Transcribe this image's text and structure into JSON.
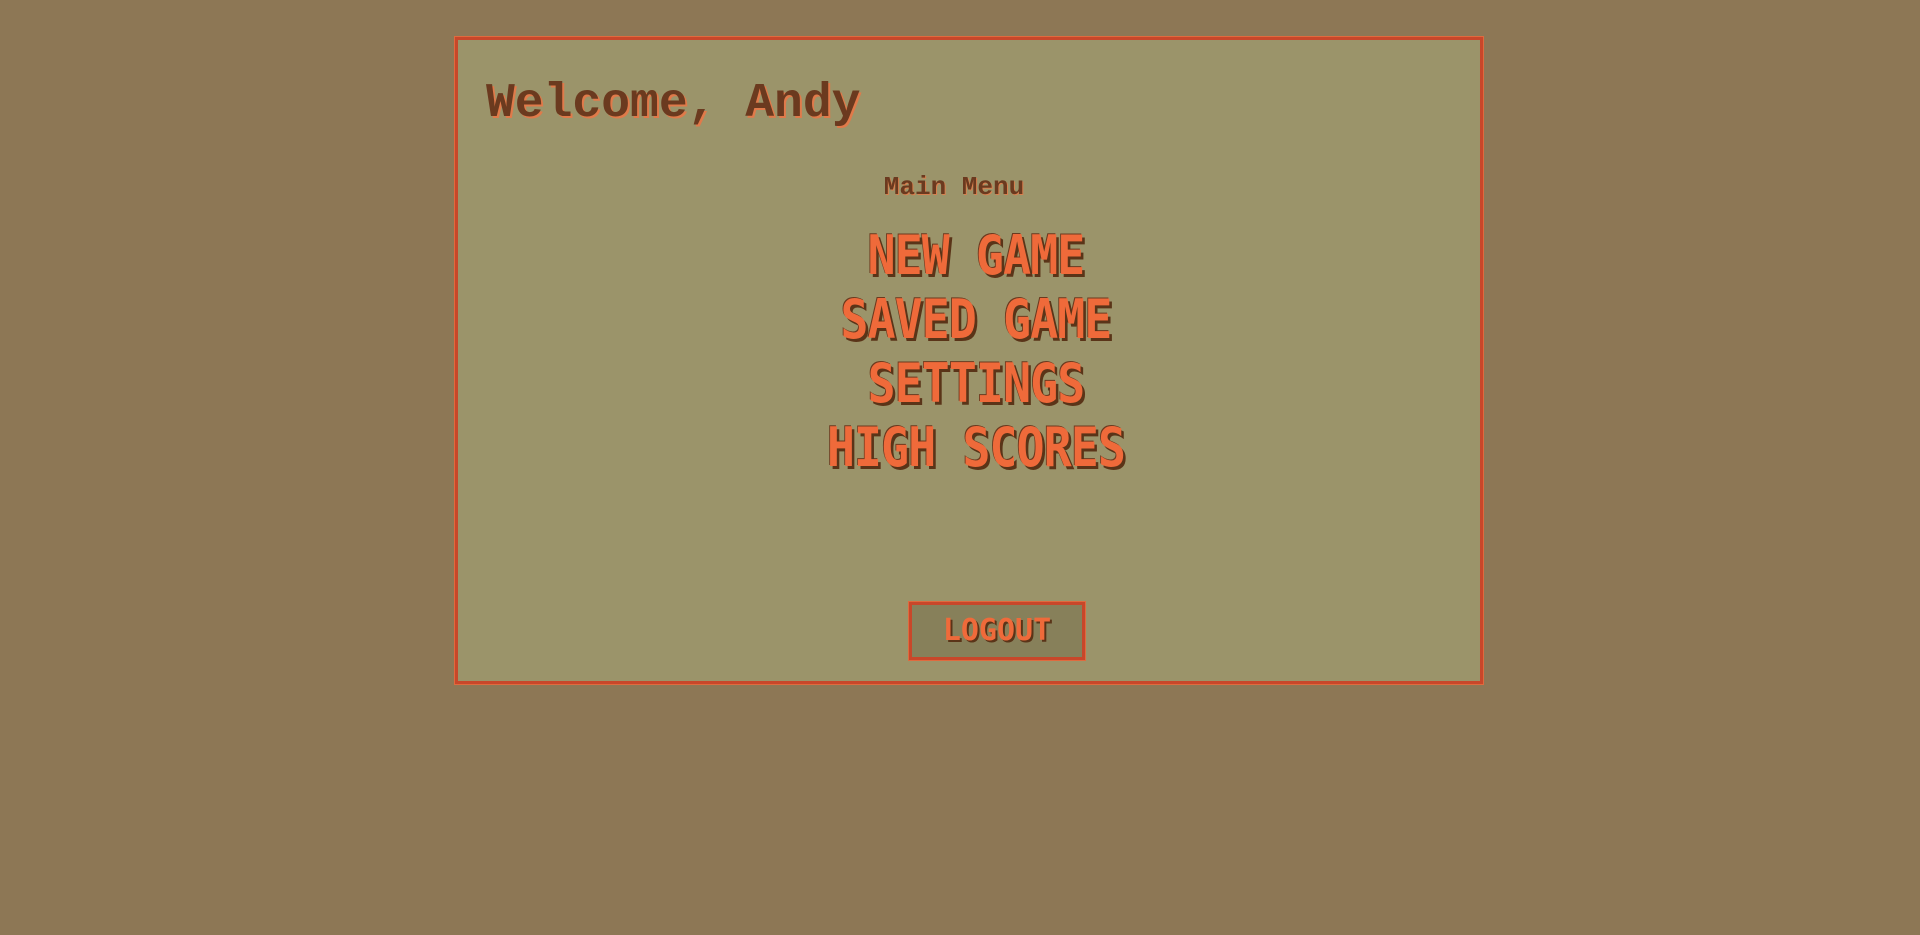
{
  "header": {
    "welcome": "Welcome, Andy"
  },
  "menu": {
    "title": "Main Menu",
    "items": [
      {
        "label": "NEW GAME"
      },
      {
        "label": "SAVED GAME"
      },
      {
        "label": "SETTINGS"
      },
      {
        "label": "HIGH SCORES"
      }
    ]
  },
  "actions": {
    "logout_label": "LOGOUT"
  },
  "colors": {
    "background": "#8d7755",
    "panel": "#9b946a",
    "border": "#c8472a",
    "accent": "#ef6a3a",
    "text_dark": "#6b3a1f"
  }
}
